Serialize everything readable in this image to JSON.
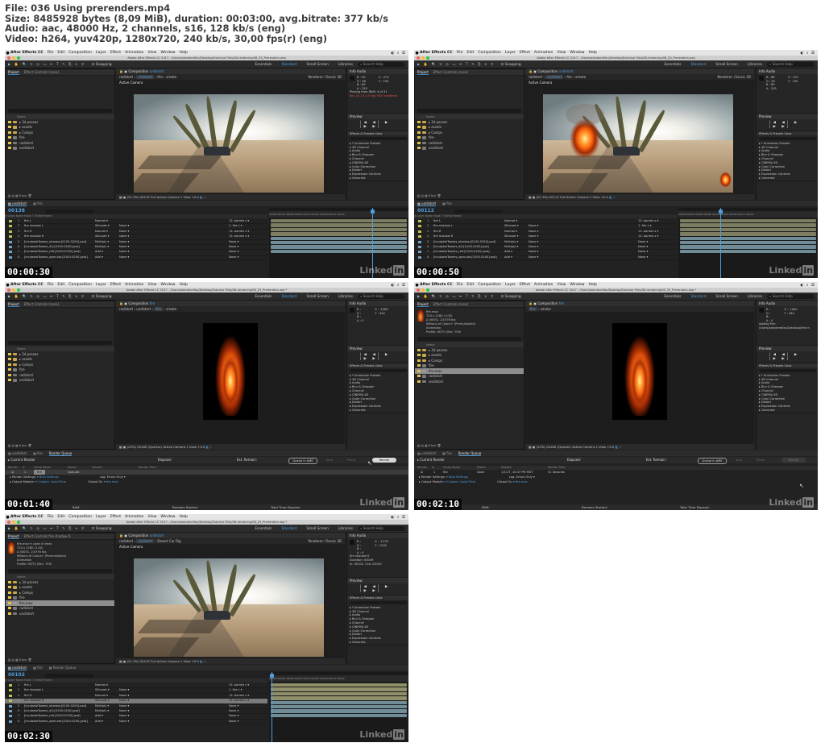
{
  "header": {
    "line1": "File: 036 Using prerenders.mp4",
    "line2": "Size: 8485928 bytes (8,09 MiB), duration: 00:03:00, avg.bitrate: 377 kb/s",
    "line3": "Audio: aac, 48000 Hz, 2 channels, s16, 128 kb/s (eng)",
    "line4": "Video: h264, yuv420p, 1280x720, 240 kb/s, 30,00 fps(r) (eng)"
  },
  "common": {
    "app_name": "After Effects CC",
    "menu": [
      "File",
      "Edit",
      "Composition",
      "Layer",
      "Effect",
      "Animation",
      "View",
      "Window",
      "Help"
    ],
    "window_title": "Adobe After Effects CC 2017 - /Users/alanderelfau/Desktop/Exercise Files/08-rendering/08_03_Prerenders.aep",
    "window_title_modified": "Adobe After Effects CC 2017 - /Users/alanderelfau/Desktop/Exercise Files/08-rendering/08_03_Prerenders.aep *",
    "snapping": "Snapping",
    "workspaces": [
      "Essentials",
      "Standard",
      "Small Screen",
      "Libraries"
    ],
    "search_help": "Search Help",
    "project_tab": "Project",
    "effect_controls_none": "Effect Controls (none)",
    "effect_controls_fire": "Effect Controls fire shadow R",
    "info_tab": "Info",
    "audio_tab": "Audio",
    "preview_tab": "Preview",
    "effects_presets_tab": "Effects & Presets",
    "libraries_tab": "Libra",
    "effects_list": [
      "* Animation Presets",
      "3D Channel",
      "Audio",
      "Blur & Sharpen",
      "Channel",
      "CINEMA 4D",
      "Color Correction",
      "Distort",
      "Expression Controls",
      "Generate"
    ],
    "preview_controls": "|◀ ◀| ▶ |▶ ▶|",
    "col_name": "Name",
    "bpc": "8 bpc",
    "renderer_label": "Renderer:",
    "renderer_value": "Classic 3D",
    "active_camera_label": "Active Camera",
    "view_label": "Active Camera",
    "one_view": "1 View",
    "zoom_value": "+0.0",
    "watermark": "Linked",
    "watermark_in": "in",
    "tl_col_headers": "#   Layer Name                               Mode      T TrkMat        Parent",
    "ruler": "00000  00030  00060  00090  00120  00150  00180  00210  00240"
  },
  "frames": [
    {
      "timestamp": "00:00:30",
      "comp_tab": "Composition undistort",
      "flow": [
        "radistort",
        "undistort",
        "fire",
        "smoke"
      ],
      "flow_highlight": 1,
      "viewer_label": "Active Camera",
      "viewer_bottom": "(51.3%)   00132   Full   Active Camera   1 View   +0.0",
      "project_items": [
        {
          "name": "3d passes",
          "type": "folder"
        },
        {
          "name": "assets",
          "type": "folder"
        },
        {
          "name": "Comps",
          "type": "folder"
        },
        {
          "name": "fire",
          "type": "comp"
        },
        {
          "name": "radistort",
          "type": "comp"
        },
        {
          "name": "undistort",
          "type": "comp"
        }
      ],
      "info_lines": [
        "R : 99",
        "G : 98",
        "B : 89",
        "A : 255",
        "X : 470",
        "Y : 190"
      ],
      "info_note": "Playing from RAM: 4 of 31",
      "info_note_red": "fps: 15.15 (15 fps; NOT realtime)",
      "tl_tabs": [
        "undistort",
        "fire"
      ],
      "timecode": "00138",
      "timecode_sub": "0:00:04:18 (30.00 fps)",
      "layers": [
        {
          "num": "1",
          "name": "fire L",
          "mode": "Normal",
          "trk": "",
          "parent": "13. barrels s"
        },
        {
          "num": "2",
          "name": "fire shadow L",
          "mode": "Silhouet",
          "trk": "None",
          "parent": "1. fire L"
        },
        {
          "num": "3",
          "name": "fire R",
          "mode": "Normal",
          "trk": "None",
          "parent": "13. barrels s"
        },
        {
          "num": "4",
          "name": "fire shadow R",
          "mode": "Silhouet",
          "trk": "None",
          "parent": "13. barrels s"
        },
        {
          "num": "5",
          "name": "[IncubateTowers_shadow.[0100-0200].psd]",
          "mode": "Multiply",
          "trk": "None",
          "parent": "None"
        },
        {
          "num": "6",
          "name": "[IncubateTowers_AO.[0100-0200].psd]",
          "mode": "Multiply",
          "trk": "None",
          "parent": "None"
        },
        {
          "num": "7",
          "name": "[IncubateTowers_refl.[0100-0200].psd]",
          "mode": "Add",
          "trk": "None",
          "parent": "None"
        },
        {
          "num": "8",
          "name": "[IncubateTowers_specular.[0100-0200].psd]",
          "mode": "Add",
          "trk": "None",
          "parent": "None"
        }
      ]
    },
    {
      "timestamp": "00:00:50",
      "comp_tab": "Composition undistort",
      "flow": [
        "radistort",
        "undistort",
        "fire",
        "smoke"
      ],
      "flow_highlight": 1,
      "viewer_label": "Active Camera",
      "viewer_bottom": "(51.3%)   00112   Full   Active Camera   1 View   +0.0",
      "project_items": [
        {
          "name": "3d passes",
          "type": "folder"
        },
        {
          "name": "assets",
          "type": "folder"
        },
        {
          "name": "Comps",
          "type": "folder"
        },
        {
          "name": "fire",
          "type": "comp"
        },
        {
          "name": "radistort",
          "type": "comp"
        },
        {
          "name": "undistort",
          "type": "comp"
        }
      ],
      "info_lines": [
        "R : 88",
        "G : 90",
        "B : 89",
        "A : 255",
        "X : 470",
        "Y : 190"
      ],
      "tl_tabs": [
        "undistort",
        "fire"
      ],
      "timecode": "00112",
      "timecode_sub": "0:00:03:22 (30.00 fps)",
      "layers": [
        {
          "num": "1",
          "name": "fire L",
          "mode": "Normal",
          "trk": "",
          "parent": "13. barrels s"
        },
        {
          "num": "2",
          "name": "fire shadow L",
          "mode": "Silhouet",
          "trk": "None",
          "parent": "1. fire L"
        },
        {
          "num": "3",
          "name": "fire R",
          "mode": "Normal",
          "trk": "None",
          "parent": "13. barrels s"
        },
        {
          "num": "4",
          "name": "fire shadow R",
          "mode": "Silhouet",
          "trk": "None",
          "parent": "13. barrels s"
        },
        {
          "num": "5",
          "name": "[IncubateTowers_shadow.[0100-0200].psd]",
          "mode": "Multiply",
          "trk": "None",
          "parent": "None"
        },
        {
          "num": "6",
          "name": "[IncubateTowers_AO.[0100-0200].psd]",
          "mode": "Multiply",
          "trk": "None",
          "parent": "None"
        },
        {
          "num": "7",
          "name": "[IncubateTowers_refl.[0100-0200].psd]",
          "mode": "Add",
          "trk": "None",
          "parent": "None"
        },
        {
          "num": "8",
          "name": "[IncubateTowers_specular.[0100-0200].psd]",
          "mode": "Add",
          "trk": "None",
          "parent": "None"
        }
      ]
    },
    {
      "timestamp": "00:01:40",
      "comp_tab": "Composition fire",
      "flow": [
        "radistort",
        "undistort",
        "fire",
        "smoke"
      ],
      "flow_highlight": 2,
      "viewer_bottom": "(25%)   00180   (Quarter)   Active Camera   1 View   +0.0",
      "project_items": [
        {
          "name": "3d passes",
          "type": "folder"
        },
        {
          "name": "assets",
          "type": "folder"
        },
        {
          "name": "Comps",
          "type": "folder"
        },
        {
          "name": "fire",
          "type": "comp"
        },
        {
          "name": "radistort",
          "type": "comp"
        },
        {
          "name": "undistort",
          "type": "comp"
        }
      ],
      "info_lines": [
        "R :",
        "G :",
        "B :",
        "A : 0",
        "X : -1080",
        "Y : 344"
      ],
      "rq_tabs": [
        "undistort",
        "fire",
        "Render Queue"
      ],
      "rq": {
        "current_render": "Current Render",
        "elapsed": "Elapsed:",
        "est_remain": "Est. Remain:",
        "queue_ame": "Queue in AME",
        "stop": "Stop",
        "pause": "Pause",
        "render": "Render",
        "cols": [
          "Render",
          "#",
          "Comp Name",
          "Status",
          "Started",
          "Render Time"
        ],
        "item_num": "1",
        "item_comp": "fire",
        "item_status": "Queued",
        "item_started": "",
        "render_settings_label": "Render Settings:",
        "render_settings_value": "Best Settings",
        "output_module_label": "Output Module:",
        "output_module_value": "Custom: QuickTime",
        "log_label": "Log:",
        "log_value": "Errors Only",
        "output_to_label": "Output To:",
        "output_to_value": "fire.mov",
        "foot_ram": "RAM:",
        "foot_started": "Renders Started:",
        "foot_total": "Total Time Elapsed:"
      }
    },
    {
      "timestamp": "00:02:10",
      "comp_tab": "Composition fire",
      "flow": [
        "fire",
        "smoke"
      ],
      "flow_highlight": 0,
      "viewer_bottom": "(25%)   00180   (Quarter)   Active Camera   1 View   +0.0",
      "proj_info": [
        "fire.mov",
        "720 x 1280 (1.00)",
        "Δ 00051, 23.976 fps",
        "Millions of Colors+ (Premultiplied)",
        "Animation",
        "",
        "Profile: HDTV (Rec. 709)"
      ],
      "project_items": [
        {
          "name": "3d passes",
          "type": "folder"
        },
        {
          "name": "assets",
          "type": "folder"
        },
        {
          "name": "Comps",
          "type": "folder"
        },
        {
          "name": "fire",
          "type": "comp"
        },
        {
          "name": "fire.mov",
          "type": "footage",
          "selected": true
        },
        {
          "name": "radistort",
          "type": "comp"
        },
        {
          "name": "undistort",
          "type": "comp"
        }
      ],
      "info_lines": [
        "R :",
        "G :",
        "B :",
        "A : 0",
        "X : -1080",
        "Y : 344"
      ],
      "info_note": "Adding File:",
      "info_note2": "/Users/alanderelfau/Desktop/fire.m",
      "rq_tabs": [
        "undistort",
        "fire",
        "Render Queue"
      ],
      "rq": {
        "current_render": "Current Render",
        "elapsed": "Elapsed:",
        "est_remain": "Est. Remain:",
        "queue_ame": "Queue in AME",
        "stop": "Stop",
        "pause": "Pause",
        "render": "Render",
        "cols": [
          "Render",
          "#",
          "Comp Name",
          "Status",
          "Started",
          "Render Time"
        ],
        "item_num": "1",
        "item_comp": "fire",
        "item_status": "Done",
        "item_started": "1/1/17, 10:47 PM MST",
        "item_time": "51 Seconds",
        "render_settings_label": "Render Settings:",
        "render_settings_value": "Best Settings",
        "output_module_label": "Output Module:",
        "output_module_value": "Custom: QuickTime",
        "log_label": "Log:",
        "log_value": "Errors Only",
        "output_to_label": "Output To:",
        "output_to_value": "fire.mov",
        "foot_ram": "RAM:",
        "foot_started": "Renders Started:",
        "foot_total": "Total Time Elapsed:"
      }
    },
    {
      "timestamp": "00:02:30",
      "comp_tab": "Composition undistort",
      "flow": [
        "radistort",
        "undistort",
        "Desert Car Rig"
      ],
      "flow_highlight": 1,
      "viewer_label": "Active Camera",
      "viewer_bottom": "(51.3%)   00102   Full   Active Camera   1 View   +0.0",
      "proj_info": [
        "fire.mov ▾, used 4 times",
        "720 x 1280 (1.00)",
        "Δ 00051, 23.976 fps",
        "Millions of Colors+ (Premultiplied)",
        "Animation",
        "",
        "Profile: HDTV (Rec. 709)"
      ],
      "project_items": [
        {
          "name": "3d passes",
          "type": "folder"
        },
        {
          "name": "assets",
          "type": "folder"
        },
        {
          "name": "Comps",
          "type": "folder"
        },
        {
          "name": "fire",
          "type": "comp"
        },
        {
          "name": "fire.mov",
          "type": "footage",
          "selected": true
        },
        {
          "name": "radistort",
          "type": "comp"
        },
        {
          "name": "undistort",
          "type": "comp"
        }
      ],
      "info_lines": [
        "R :",
        "G :",
        "B :",
        "A : 0",
        "X : -1176",
        "Y : 1032"
      ],
      "info_note": "fire shadow R",
      "info_note2": "Duration: 00049",
      "info_note3": "In: 00102, Out: 00150",
      "tl_tabs": [
        "undistort",
        "fire",
        "Render Queue"
      ],
      "timecode": "00102",
      "timecode_sub": "0:00:03:12 (30.00 fps)",
      "layers": [
        {
          "num": "1",
          "name": "fire L",
          "mode": "Normal",
          "trk": "",
          "parent": "13. barrels s"
        },
        {
          "num": "2",
          "name": "fire shadow L",
          "mode": "Silhouet",
          "trk": "None",
          "parent": "1. fire L"
        },
        {
          "num": "3",
          "name": "fire R",
          "mode": "Normal",
          "trk": "None",
          "parent": "13. barrels s"
        },
        {
          "num": "4",
          "name": "fire shadow R",
          "mode": "Silhouet",
          "trk": "None",
          "parent": "13. barrels s",
          "selected": true
        },
        {
          "num": "5",
          "name": "[IncubateTowers_shadow.[0100-0200].psd]",
          "mode": "Multiply",
          "trk": "None",
          "parent": "None"
        },
        {
          "num": "6",
          "name": "[IncubateTowers_AO.[0100-0200].psd]",
          "mode": "Multiply",
          "trk": "None",
          "parent": "None"
        },
        {
          "num": "7",
          "name": "[IncubateTowers_refl.[0100-0200].psd]",
          "mode": "Add",
          "trk": "None",
          "parent": "None"
        },
        {
          "num": "8",
          "name": "[IncubateTowers_specular.[0100-0200].psd]",
          "mode": "Add",
          "trk": "None",
          "parent": "None"
        }
      ]
    }
  ]
}
